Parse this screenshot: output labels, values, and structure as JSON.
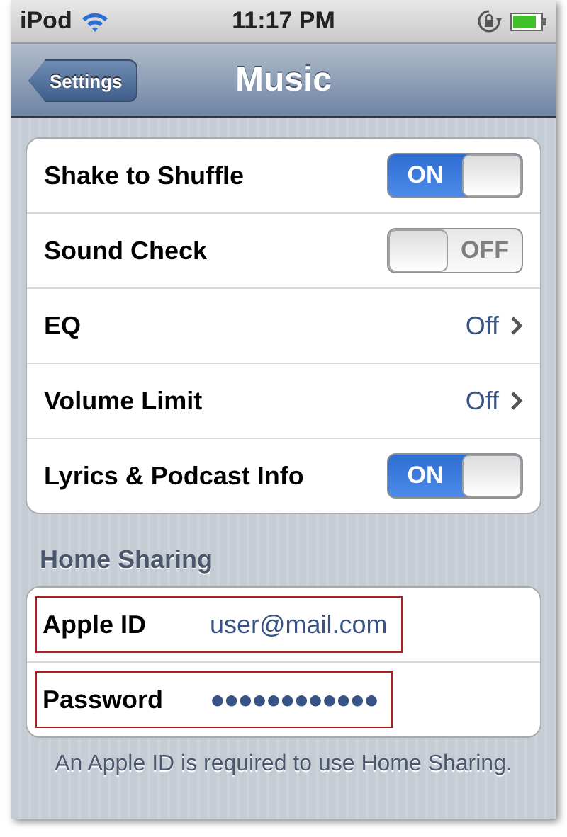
{
  "status_bar": {
    "carrier": "iPod",
    "time": "11:17 PM"
  },
  "nav_bar": {
    "back": "Settings",
    "title": "Music"
  },
  "settings": [
    {
      "kind": "switch",
      "label": "Shake to Shuffle",
      "on": true,
      "state_text": "ON"
    },
    {
      "kind": "switch",
      "label": "Sound Check",
      "on": false,
      "state_text": "OFF"
    },
    {
      "kind": "disclosure",
      "label": "EQ",
      "value": "Off"
    },
    {
      "kind": "disclosure",
      "label": "Volume Limit",
      "value": "Off"
    },
    {
      "kind": "switch",
      "label": "Lyrics & Podcast Info",
      "on": true,
      "state_text": "ON"
    }
  ],
  "home_sharing": {
    "header": "Home Sharing",
    "fields": [
      {
        "label": "Apple ID",
        "value": "user@mail.com",
        "highlighted": true
      },
      {
        "label": "Password",
        "value": "●●●●●●●●●●●●",
        "highlighted": true
      }
    ],
    "footer": "An Apple ID is required to use Home Sharing."
  }
}
